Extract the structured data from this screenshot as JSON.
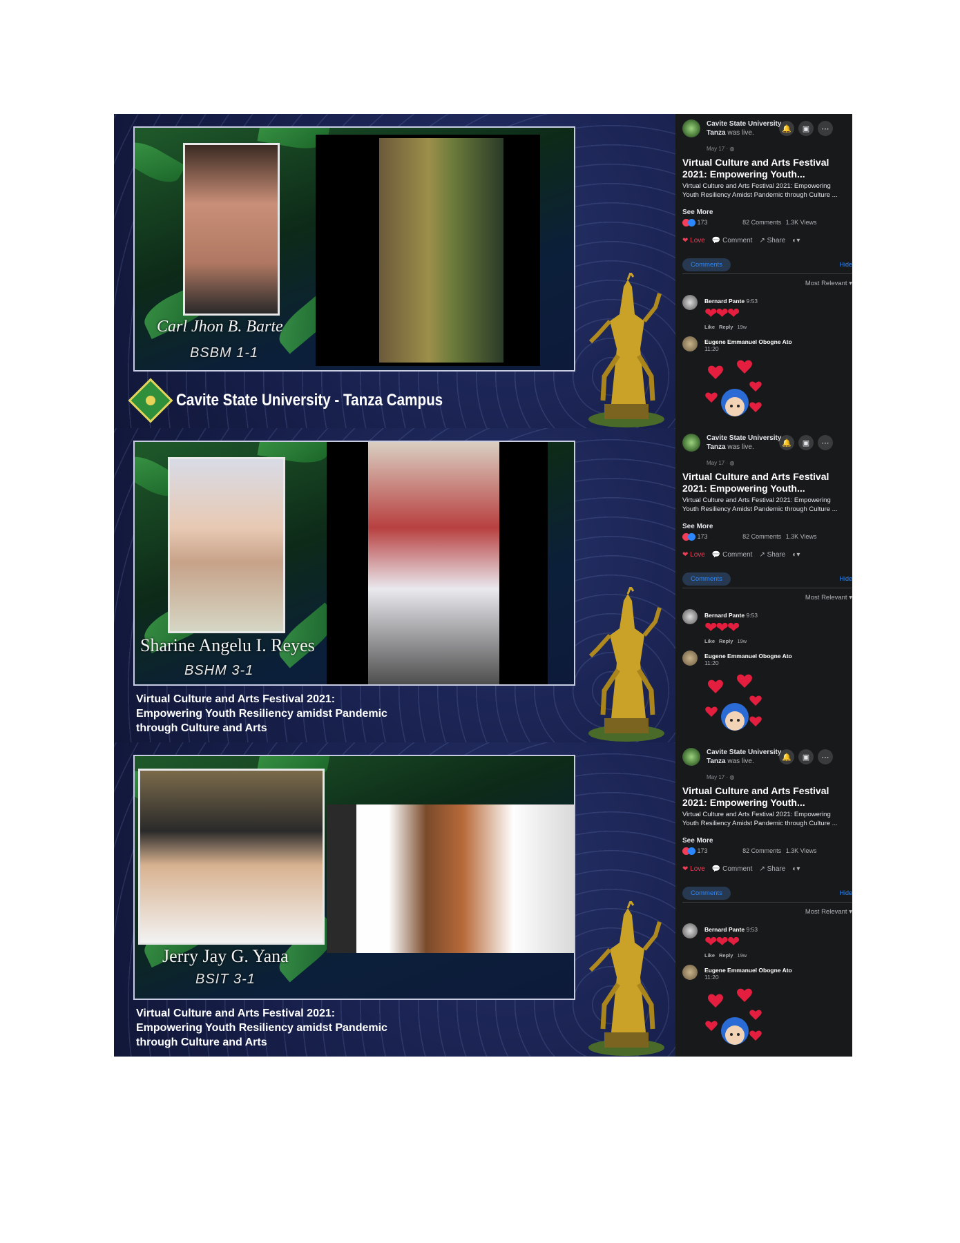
{
  "panels": [
    {
      "student_name": "Carl Jhon B. Barte",
      "course": "BSBM 1-1",
      "footer_type": "campus",
      "campus_name": "Cavite State University - Tanza Campus",
      "caption_lines": []
    },
    {
      "student_name": "Sharine Angelu I. Reyes",
      "course": "BSHM 3-1",
      "footer_type": "caption",
      "campus_name": "",
      "caption_lines": [
        "Virtual Culture and Arts Festival 2021:",
        "Empowering Youth Resiliency amidst Pandemic",
        "through Culture and Arts"
      ]
    },
    {
      "student_name": "Jerry Jay G. Yana",
      "course": "BSIT 3-1",
      "footer_type": "caption",
      "campus_name": "",
      "caption_lines": [
        "Virtual Culture and Arts Festival 2021:",
        "Empowering Youth Resiliency amidst Pandemic",
        "through Culture and Arts"
      ]
    }
  ],
  "facebook": {
    "page_name": "Cavite State University - Tanza",
    "was_live": "was live.",
    "date": "May 17 · ",
    "post_title": "Virtual Culture and Arts Festival 2021: Empowering Youth...",
    "description": "Virtual Culture and Arts Festival 2021: Empowering Youth Resiliency Amidst Pandemic through Culture ...",
    "see_more": "See More",
    "reaction_count": "173",
    "comments_count": "82 Comments",
    "views_count": "1.3K Views",
    "love_label": "Love",
    "comment_label": "Comment",
    "share_label": "Share",
    "comments_tab": "Comments",
    "hide_label": "Hide",
    "sort_label": "Most Relevant",
    "comments": [
      {
        "author": "Bernard Pante",
        "time": "9:53",
        "content": "❤❤❤",
        "like": "Like",
        "reply": "Reply",
        "age": "19w"
      },
      {
        "author": "Eugene Emmanuel Obogne Ato",
        "time": "11:20"
      }
    ]
  },
  "colors": {
    "stream_bg": "#18204d",
    "fb_bg": "#18191a",
    "fb_accent": "#2d88ff",
    "love": "#f33e58"
  }
}
